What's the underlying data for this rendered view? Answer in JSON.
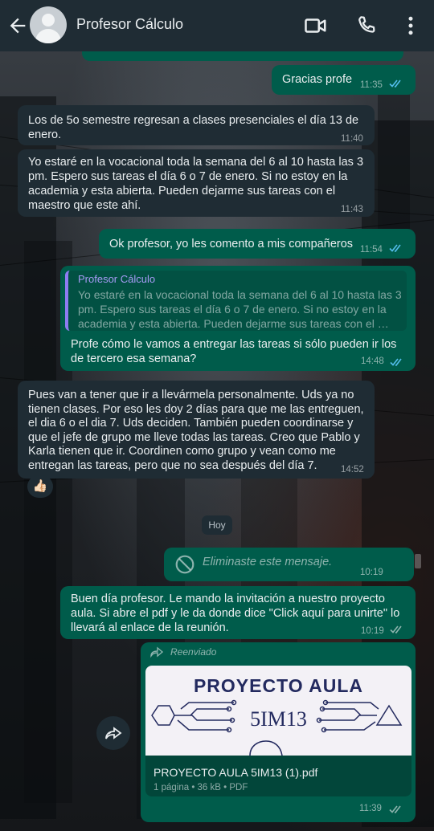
{
  "header": {
    "contact_name": "Profesor Cálculo",
    "back_icon": "arrow-left-icon",
    "video_icon": "video-call-icon",
    "call_icon": "phone-icon",
    "menu_icon": "more-vertical-icon"
  },
  "messages": [
    {
      "dir": "out",
      "text": "Gracias profe",
      "time": "11:35",
      "status": "read"
    },
    {
      "dir": "in",
      "text": "Los de 5o semestre regresan a clases presenciales el día 13 de enero.",
      "time": "11:40"
    },
    {
      "dir": "in",
      "text": "Yo estaré en la vocacional toda la semana del 6 al 10 hasta las 3 pm. Espero sus tareas el día 6 o 7 de enero. Si no estoy en la academia y esta abierta. Pueden dejarme sus tareas con el maestro que este ahí.",
      "time": "11:43"
    },
    {
      "dir": "out",
      "text": "Ok profesor, yo les comento a mis compañeros",
      "time": "11:54",
      "status": "read"
    },
    {
      "dir": "out",
      "quote_name": "Profesor Cálculo",
      "quote_text": "Yo estaré en la vocacional toda la semana del 6 al 10 hasta las 3 pm. Espero sus tareas el día 6 o 7 de enero. Si no estoy en la academia y esta abierta. Pueden dejarme sus tareas con el …",
      "text": "Profe cómo le vamos a entregar las tareas si sólo pueden ir los de tercero esa semana?",
      "time": "14:48",
      "status": "read"
    },
    {
      "dir": "in",
      "text": "Pues van a tener que ir a llevármela personalmente. Uds ya no tienen clases. Por eso les doy 2 días para que me las entreguen, el dia 6 o el dia 7. Uds deciden. También pueden coordinarse y que el jefe de grupo me lleve todas las tareas. Creo que Pablo y Karla tienen que ir. Coordinen como grupo y vean como me entregan las tareas, pero que no sea después del día 7.",
      "time": "14:52",
      "reaction": "👍🏻"
    },
    {
      "dir": "out",
      "deleted": true,
      "text": "Eliminaste este mensaje.",
      "time": "10:19"
    },
    {
      "dir": "out",
      "text": "Buen día profesor. Le mando la invitación a nuestro proyecto aula. Si abre el pdf y le da donde dice \"Click aquí para unirte\" lo llevará al enlace de la reunión.",
      "time": "10:19",
      "status": "delivered"
    },
    {
      "dir": "out",
      "forwarded_label": "Reenviado",
      "document": {
        "thumb_title": "PROYECTO AULA",
        "thumb_subtitle": "5IM13",
        "name": "PROYECTO AULA 5IM13 (1).pdf",
        "meta": "1 página • 36 kB • PDF"
      },
      "time": "11:39",
      "status": "delivered"
    }
  ],
  "date_chip": "Hoy",
  "colors": {
    "header_bg": "#1f2c34",
    "incoming_bg": "#1f2c34",
    "outgoing_bg": "#005c4b",
    "read_ticks": "#53bdeb",
    "quote_accent": "#8e7cf1"
  }
}
